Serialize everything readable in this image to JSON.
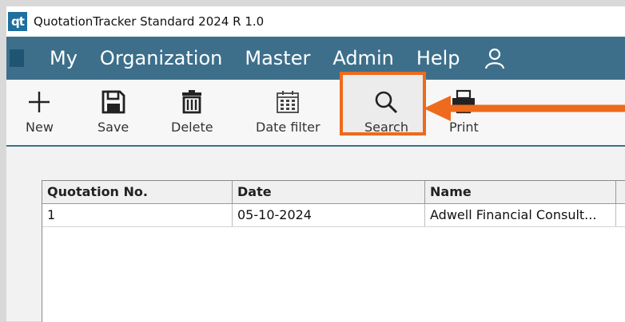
{
  "titlebar": {
    "logo_text": "qt",
    "title": "QuotationTracker Standard 2024 R 1.0"
  },
  "menu": {
    "items": [
      "My",
      "Organization",
      "Master",
      "Admin",
      "Help"
    ],
    "user_icon": "user-icon"
  },
  "toolbar": {
    "new_label": "New",
    "save_label": "Save",
    "delete_label": "Delete",
    "date_filter_label": "Date filter",
    "search_label": "Search",
    "print_label": "Print"
  },
  "grid": {
    "columns": [
      "Quotation No.",
      "Date",
      "Name"
    ],
    "rows": [
      [
        "1",
        "05-10-2024",
        "Adwell Financial Consult..."
      ]
    ]
  },
  "colors": {
    "menubar": "#3d6f8b",
    "highlight": "#ee6a1c"
  }
}
